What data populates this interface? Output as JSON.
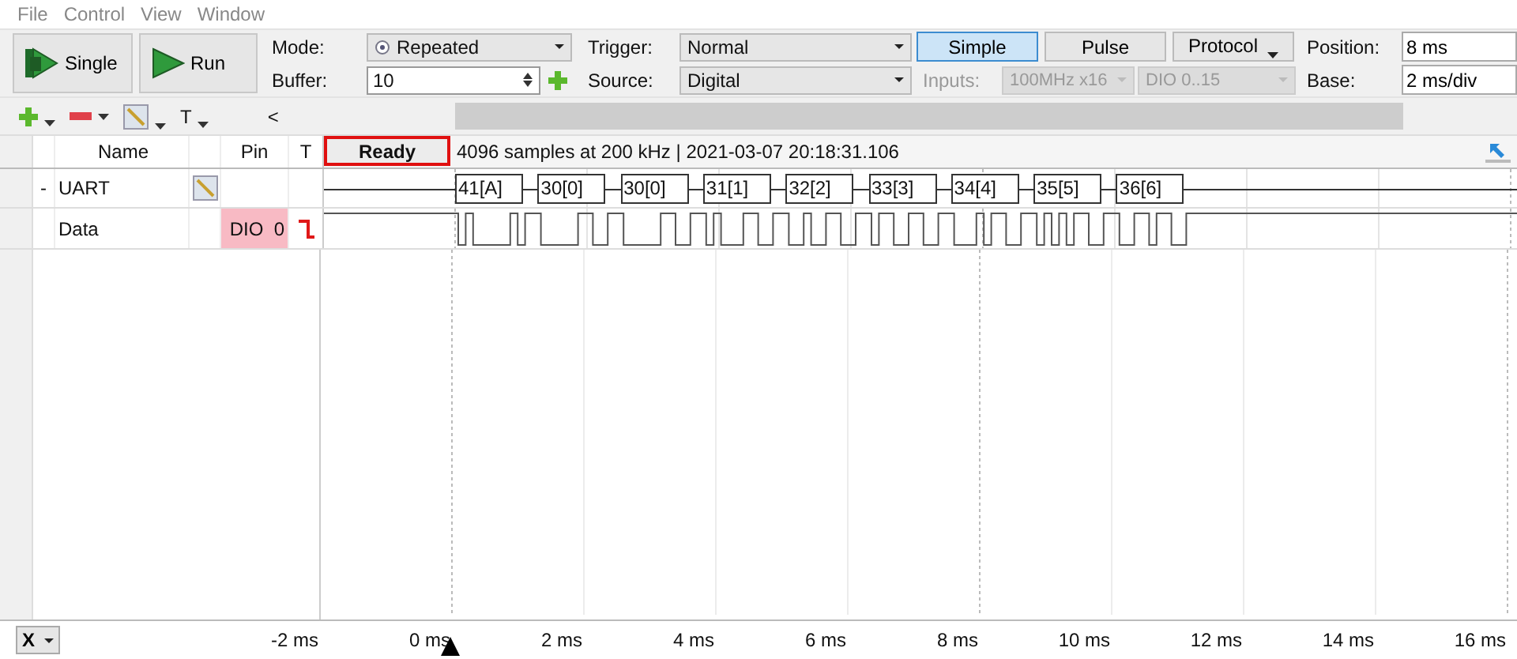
{
  "menu": [
    {
      "label": "File"
    },
    {
      "label": "Control"
    },
    {
      "label": "View"
    },
    {
      "label": "Window"
    }
  ],
  "run_buttons": [
    {
      "label": "Single",
      "kind": "single"
    },
    {
      "label": "Run",
      "kind": "run"
    }
  ],
  "mode": {
    "label": "Mode:",
    "value": "Repeated"
  },
  "buffer": {
    "label": "Buffer:",
    "value": "10"
  },
  "trigger": {
    "label": "Trigger:",
    "value": "Normal"
  },
  "source": {
    "label": "Source:",
    "value": "Digital"
  },
  "trigger_types": [
    {
      "label": "Simple",
      "selected": true,
      "has_menu": false
    },
    {
      "label": "Pulse",
      "selected": false,
      "has_menu": false
    },
    {
      "label": "Protocol",
      "selected": false,
      "has_menu": true
    }
  ],
  "inputs": {
    "label": "Inputs:",
    "disabled": true,
    "rate": "100MHz x16",
    "pins": "DIO 0..15"
  },
  "position": {
    "label": "Position:",
    "value": "8 ms"
  },
  "base": {
    "label": "Base:",
    "value": "2 ms/div"
  },
  "edit_tools": [
    {
      "kind": "add"
    },
    {
      "kind": "remove"
    },
    {
      "kind": "edit"
    },
    {
      "kind": "text",
      "label": "T"
    }
  ],
  "collapse_label": "<",
  "columns": {
    "name": "Name",
    "pin": "Pin",
    "trigger": "T"
  },
  "status": "Ready",
  "capture_info": "4096 samples at 200 kHz | 2021-03-07 20:18:31.106",
  "signals": [
    {
      "kind": "bus",
      "name": "UART",
      "expander": "-",
      "frames": [
        "41[A]",
        "30[0]",
        "30[0]",
        "31[1]",
        "32[2]",
        "33[3]",
        "34[4]",
        "35[5]",
        "36[6]"
      ]
    },
    {
      "kind": "channel",
      "name": "Data",
      "pin": "DIO  0",
      "falling_edge_trigger": true
    }
  ],
  "axis": {
    "label": "X",
    "ticks": [
      "-2 ms",
      "0 ms",
      "2 ms",
      "4 ms",
      "6 ms",
      "8 ms",
      "10 ms",
      "12 ms",
      "14 ms",
      "16 ms"
    ]
  }
}
